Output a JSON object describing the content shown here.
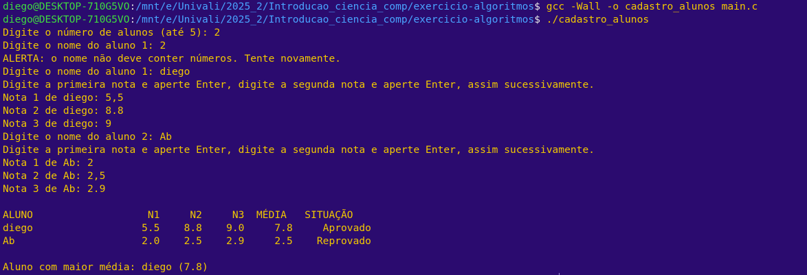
{
  "colors": {
    "background": "#2b0b6f",
    "text": "#f2c800",
    "prompt_user": "#3fdc3f",
    "prompt_path": "#4aa3ff"
  },
  "prompt": {
    "user_host": "diego@DESKTOP-710G5VO",
    "sep": ":",
    "path": "/mnt/e/Univali/2025_2/Introducao_ciencia_comp/exercicio-algoritmos",
    "symbol": "$"
  },
  "commands": [
    " gcc -Wall -o cadastro_alunos main.c",
    " ./cadastro_alunos"
  ],
  "output_lines": [
    "Digite o número de alunos (até 5): 2",
    "Digite o nome do aluno 1: 2",
    "ALERTA: o nome não deve conter números. Tente novamente.",
    "Digite o nome do aluno 1: diego",
    "Digite a primeira nota e aperte Enter, digite a segunda nota e aperte Enter, assim sucessivamente.",
    "Nota 1 de diego: 5,5",
    "Nota 2 de diego: 8.8",
    "Nota 3 de diego: 9",
    "Digite o nome do aluno 2: Ab",
    "Digite a primeira nota e aperte Enter, digite a segunda nota e aperte Enter, assim sucessivamente.",
    "Nota 1 de Ab: 2",
    "Nota 2 de Ab: 2,5",
    "Nota 3 de Ab: 2.9"
  ],
  "table": {
    "header": "ALUNO                   N1     N2     N3  MÉDIA   SITUAÇÃO",
    "rows": [
      "diego                  5.5    8.8    9.0     7.8     Aprovado",
      "Ab                     2.0    2.5    2.9     2.5    Reprovado"
    ]
  },
  "summary": "Aluno com maior média: diego (7.8)"
}
